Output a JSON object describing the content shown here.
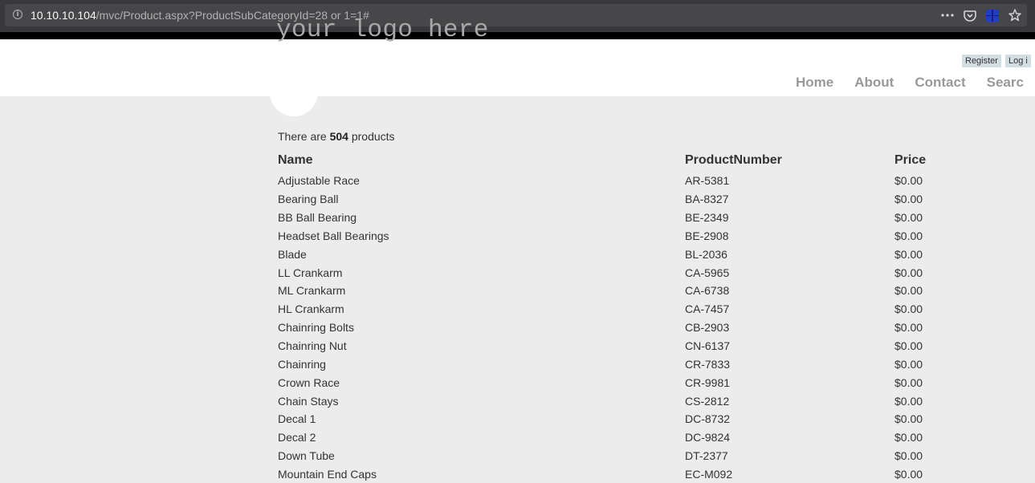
{
  "browser": {
    "url_host": "10.10.10.104",
    "url_path": "/mvc/Product.aspx?ProductSubCategoryId=28 or 1=1#",
    "icons": [
      "info-icon",
      "more-icon",
      "pocket-icon",
      "windows-extension-icon",
      "bookmark-star-icon"
    ]
  },
  "header": {
    "logo_text": "your logo here",
    "register_label": "Register",
    "login_label": "Log i",
    "nav": [
      "Home",
      "About",
      "Contact",
      "Searc"
    ]
  },
  "main": {
    "count_prefix": "There are",
    "count_value": "504",
    "count_suffix": "products",
    "columns": [
      "Name",
      "ProductNumber",
      "Price"
    ],
    "rows": [
      {
        "name": "Adjustable Race",
        "number": "AR-5381",
        "price": "$0.00"
      },
      {
        "name": "Bearing Ball",
        "number": "BA-8327",
        "price": "$0.00"
      },
      {
        "name": "BB Ball Bearing",
        "number": "BE-2349",
        "price": "$0.00"
      },
      {
        "name": "Headset Ball Bearings",
        "number": "BE-2908",
        "price": "$0.00"
      },
      {
        "name": "Blade",
        "number": "BL-2036",
        "price": "$0.00"
      },
      {
        "name": "LL Crankarm",
        "number": "CA-5965",
        "price": "$0.00"
      },
      {
        "name": "ML Crankarm",
        "number": "CA-6738",
        "price": "$0.00"
      },
      {
        "name": "HL Crankarm",
        "number": "CA-7457",
        "price": "$0.00"
      },
      {
        "name": "Chainring Bolts",
        "number": "CB-2903",
        "price": "$0.00"
      },
      {
        "name": "Chainring Nut",
        "number": "CN-6137",
        "price": "$0.00"
      },
      {
        "name": "Chainring",
        "number": "CR-7833",
        "price": "$0.00"
      },
      {
        "name": "Crown Race",
        "number": "CR-9981",
        "price": "$0.00"
      },
      {
        "name": "Chain Stays",
        "number": "CS-2812",
        "price": "$0.00"
      },
      {
        "name": "Decal 1",
        "number": "DC-8732",
        "price": "$0.00"
      },
      {
        "name": "Decal 2",
        "number": "DC-9824",
        "price": "$0.00"
      },
      {
        "name": "Down Tube",
        "number": "DT-2377",
        "price": "$0.00"
      },
      {
        "name": "Mountain End Caps",
        "number": "EC-M092",
        "price": "$0.00"
      }
    ]
  }
}
